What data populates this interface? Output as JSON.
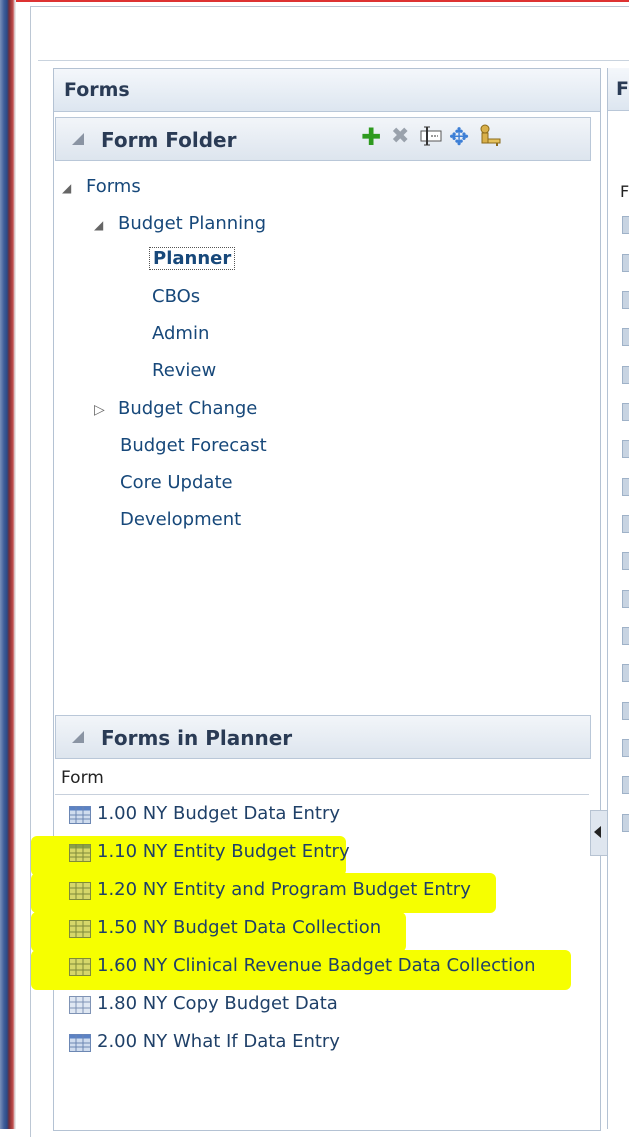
{
  "forms_panel": {
    "title": "Forms"
  },
  "folder_section": {
    "title": "Form Folder",
    "toolbar_icons": [
      "add-icon",
      "delete-icon",
      "rename-icon",
      "move-icon",
      "assign-access-icon"
    ]
  },
  "tree": {
    "root": "Forms",
    "budget_planning": "Budget Planning",
    "planner": "Planner",
    "cbos": "CBOs",
    "admin": "Admin",
    "review": "Review",
    "budget_change": "Budget Change",
    "budget_forecast": "Budget Forecast",
    "core_update": "Core Update",
    "development": "Development"
  },
  "forms_list": {
    "title": "Forms in Planner",
    "column_header": "Form",
    "items": [
      {
        "label": "1.00 NY Budget Data Entry",
        "highlighted": false
      },
      {
        "label": "1.10 NY Entity Budget Entry",
        "highlighted": true
      },
      {
        "label": "1.20 NY Entity and Program Budget Entry",
        "highlighted": true
      },
      {
        "label": "1.50 NY Budget Data Collection",
        "highlighted": true
      },
      {
        "label": "1.60 NY Clinical Revenue Badget Data Collection",
        "highlighted": true
      },
      {
        "label": "1.80 NY Copy Budget Data",
        "highlighted": false
      },
      {
        "label": "2.00 NY What If Data Entry",
        "highlighted": false
      }
    ]
  },
  "right_panel": {
    "title": "F",
    "column_header": "F"
  },
  "colors": {
    "highlight": "#f6ff00",
    "link_text": "#17487a",
    "header_text": "#2a3b55"
  }
}
